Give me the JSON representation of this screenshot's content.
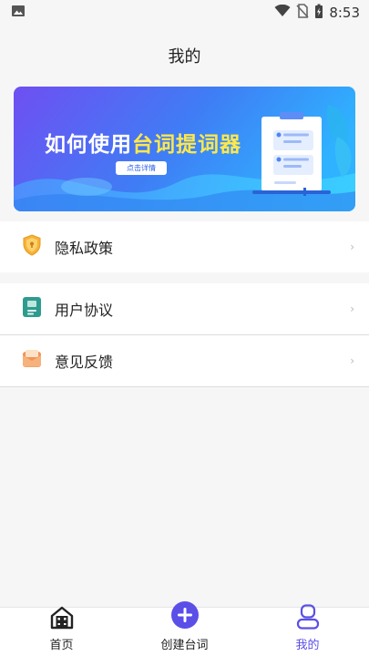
{
  "status_bar": {
    "time": "8:53"
  },
  "header": {
    "title": "我的"
  },
  "banner": {
    "title_prefix": "如何使用",
    "title_highlight": "台词提词器",
    "button_label": "点击详情"
  },
  "menu": {
    "group1": [
      {
        "label": "隐私政策",
        "icon": "shield-icon",
        "color": "#f5a623"
      }
    ],
    "group2": [
      {
        "label": "用户协议",
        "icon": "book-icon",
        "color": "#2e9b8e"
      },
      {
        "label": "意见反馈",
        "icon": "mail-icon",
        "color": "#f0945a"
      }
    ],
    "chevron": "›"
  },
  "tabbar": {
    "tabs": [
      {
        "label": "首页",
        "icon": "home-icon"
      },
      {
        "label": "创建台词",
        "icon": "plus-circle-icon"
      },
      {
        "label": "我的",
        "icon": "user-icon",
        "active": true
      }
    ]
  },
  "colors": {
    "accent": "#5b4fe8",
    "banner_start": "#6f4ff2",
    "banner_end": "#2fa8ff"
  }
}
